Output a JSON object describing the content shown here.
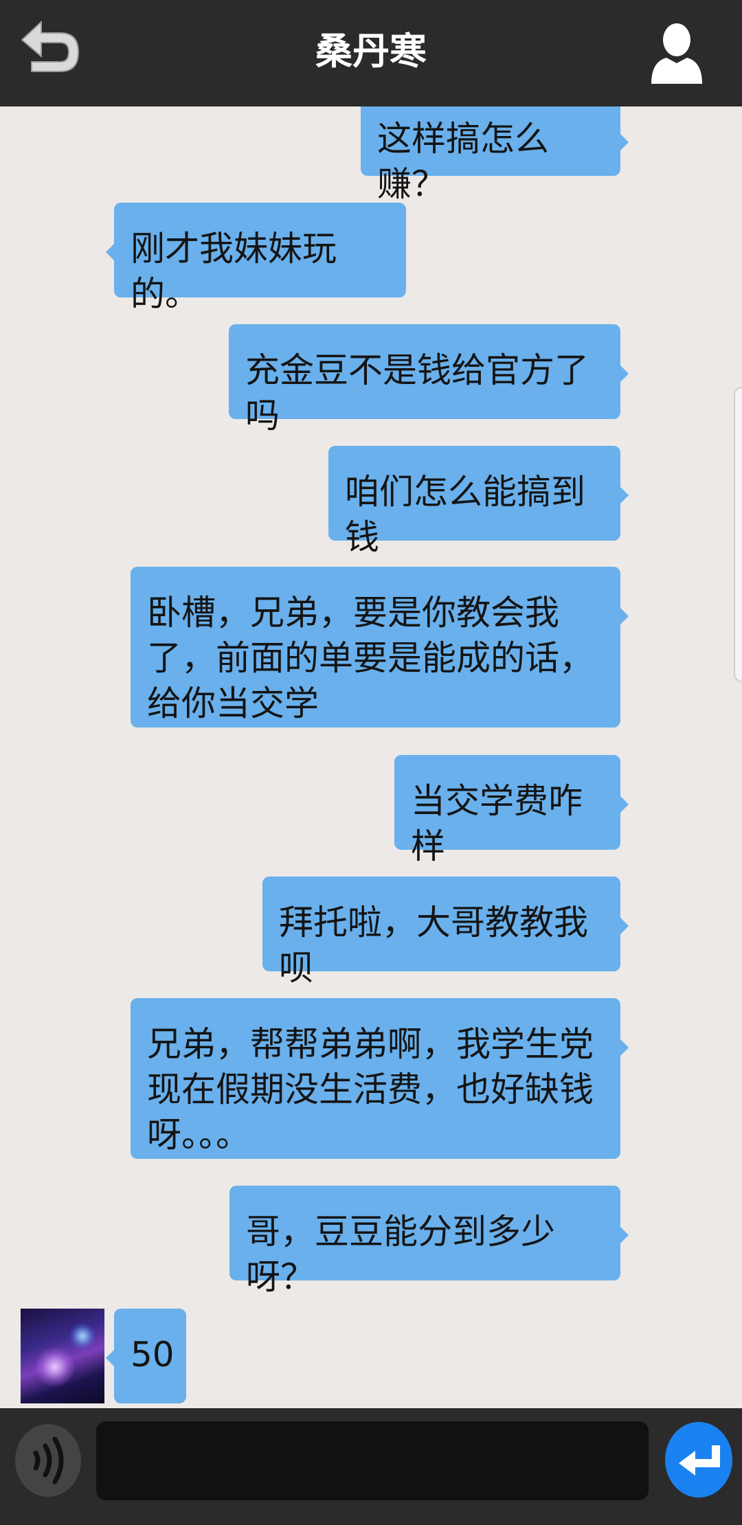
{
  "header": {
    "title": "桑丹寒"
  },
  "messages": [
    {
      "side": "right",
      "text": "这样搞怎么赚？"
    },
    {
      "side": "left",
      "text": "刚才我妹妹玩的。"
    },
    {
      "side": "right",
      "text": "充金豆不是钱给官方了吗"
    },
    {
      "side": "right",
      "text": "咱们怎么能搞到钱"
    },
    {
      "side": "right",
      "text": "卧槽，兄弟，要是你教会我了，前面的单要是能成的话，给你当交学"
    },
    {
      "side": "right",
      "text": "当交学费咋样"
    },
    {
      "side": "right",
      "text": "拜托啦，大哥教教我呗"
    },
    {
      "side": "right",
      "text": "兄弟，帮帮弟弟啊，我学生党现在假期没生活费，也好缺钱呀。。。"
    },
    {
      "side": "right",
      "text": "哥，豆豆能分到多少呀？"
    },
    {
      "side": "left",
      "text": "50"
    }
  ],
  "input": {
    "value": "",
    "placeholder": ""
  },
  "icons": {
    "back": "back-arrow-icon",
    "profile": "person-icon",
    "voice": "voice-icon",
    "send": "enter-icon"
  },
  "colors": {
    "header_bg": "#2B2B2B",
    "chat_bg": "#ECE9E7",
    "bubble": "#69B0EC",
    "send_button": "#1A82F0"
  }
}
